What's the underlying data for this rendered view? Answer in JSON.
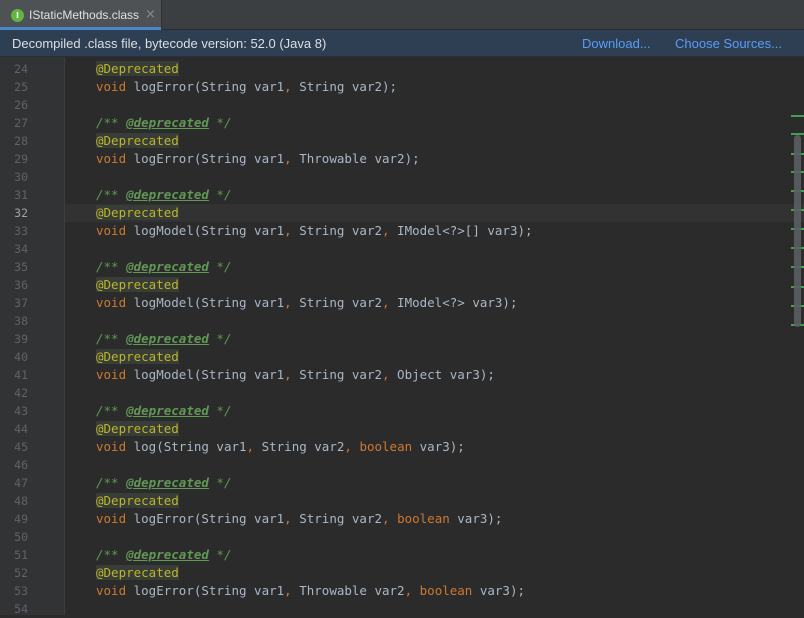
{
  "tab": {
    "title": "IStaticMethods.class",
    "icon": "class-file-icon",
    "icon_glyph": "I",
    "close": "×"
  },
  "banner": {
    "text": "Decompiled .class file, bytecode version: 52.0 (Java 8)",
    "download": "Download...",
    "choose_sources": "Choose Sources..."
  },
  "editor": {
    "current_line": 32,
    "lines": [
      {
        "n": "24",
        "t": "@Deprecated"
      },
      {
        "n": "25",
        "t": "void logError(String var1, String var2);"
      },
      {
        "n": "26",
        "t": ""
      },
      {
        "n": "27",
        "t": "/** @deprecated */"
      },
      {
        "n": "28",
        "t": "@Deprecated"
      },
      {
        "n": "29",
        "t": "void logError(String var1, Throwable var2);"
      },
      {
        "n": "30",
        "t": ""
      },
      {
        "n": "31",
        "t": "/** @deprecated */"
      },
      {
        "n": "32",
        "t": "@Deprecated"
      },
      {
        "n": "33",
        "t": "void logModel(String var1, String var2, IModel<?>[] var3);"
      },
      {
        "n": "34",
        "t": ""
      },
      {
        "n": "35",
        "t": "/** @deprecated */"
      },
      {
        "n": "36",
        "t": "@Deprecated"
      },
      {
        "n": "37",
        "t": "void logModel(String var1, String var2, IModel<?> var3);"
      },
      {
        "n": "38",
        "t": ""
      },
      {
        "n": "39",
        "t": "/** @deprecated */"
      },
      {
        "n": "40",
        "t": "@Deprecated"
      },
      {
        "n": "41",
        "t": "void logModel(String var1, String var2, Object var3);"
      },
      {
        "n": "42",
        "t": ""
      },
      {
        "n": "43",
        "t": "/** @deprecated */"
      },
      {
        "n": "44",
        "t": "@Deprecated"
      },
      {
        "n": "45",
        "t": "void log(String var1, String var2, boolean var3);"
      },
      {
        "n": "46",
        "t": ""
      },
      {
        "n": "47",
        "t": "/** @deprecated */"
      },
      {
        "n": "48",
        "t": "@Deprecated"
      },
      {
        "n": "49",
        "t": "void logError(String var1, String var2, boolean var3);"
      },
      {
        "n": "50",
        "t": ""
      },
      {
        "n": "51",
        "t": "/** @deprecated */"
      },
      {
        "n": "52",
        "t": "@Deprecated"
      },
      {
        "n": "53",
        "t": "void logError(String var1, Throwable var2, boolean var3);"
      },
      {
        "n": "54",
        "t": ""
      }
    ]
  },
  "colors": {
    "background": "#2b2b2b",
    "keyword": "#cc7832",
    "annotation": "#bbb529",
    "doc_comment": "#629755",
    "text": "#a9b7c6",
    "link": "#589df6"
  }
}
